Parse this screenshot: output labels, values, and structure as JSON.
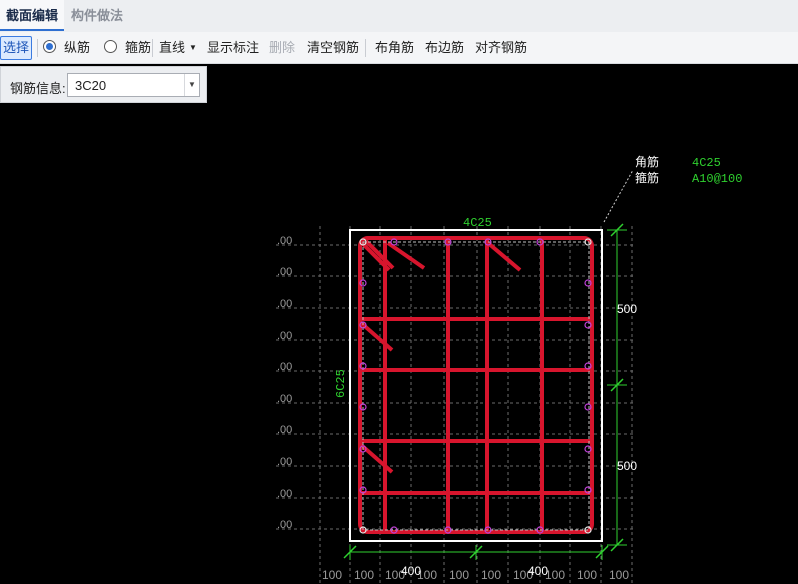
{
  "tabs": [
    {
      "label": "截面编辑"
    },
    {
      "label": "构件做法"
    }
  ],
  "toolbar": {
    "select": "选择",
    "radio_longitudinal": "纵筋",
    "radio_stirrup": "箍筋",
    "line": "直线",
    "show_dimensions": "显示标注",
    "delete": "删除",
    "clear_rebar": "清空钢筋",
    "corner_rebar": "布角筋",
    "edge_rebar": "布边筋",
    "align_rebar": "对齐钢筋"
  },
  "rebar_info": {
    "label": "钢筋信息:",
    "value": "3C20"
  },
  "drawing": {
    "callout": {
      "corner_label": "角筋",
      "corner_value": "4C25",
      "stirrup_label": "箍筋",
      "stirrup_value": "A10@100"
    },
    "top_edge_label": "4C25",
    "left_edge_label": "6C25",
    "right_dims": [
      "500",
      "500"
    ],
    "bottom_dims": [
      "400",
      "400"
    ],
    "grid_label": "100",
    "left_grid_label": ".00"
  },
  "colors": {
    "rebar": "#d7152d",
    "dim_green": "#2fd12f",
    "marker": "#c040d8",
    "background": "#000000"
  }
}
